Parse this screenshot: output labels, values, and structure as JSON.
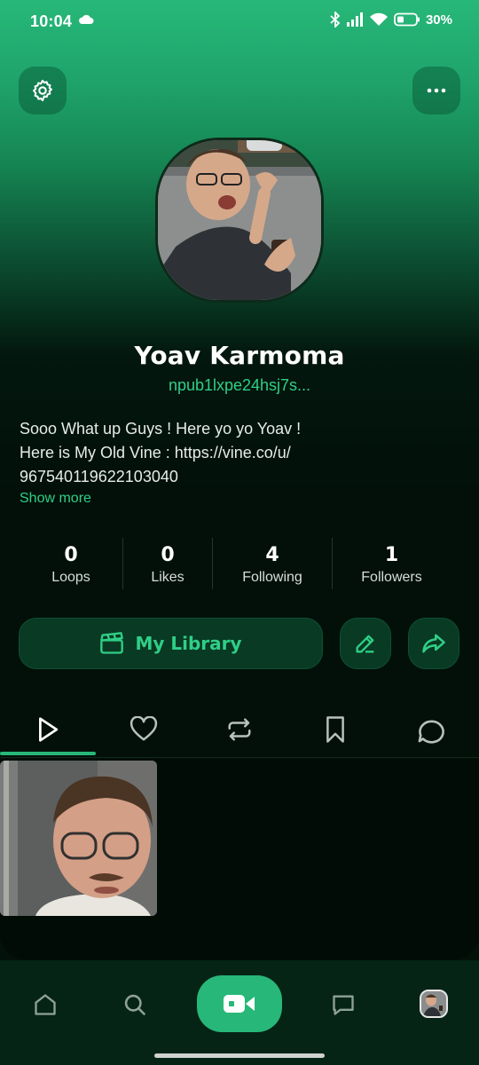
{
  "status_bar": {
    "time": "10:04",
    "battery": "30%"
  },
  "header": {
    "settings_icon": "gear-icon",
    "more_icon": "more-horizontal-icon"
  },
  "profile": {
    "name": "Yoav Karmoma",
    "npub": "npub1lxpe24hsj7s...",
    "bio_lines": [
      "Sooo What up Guys ! Here yo yo Yoav !",
      "Here is My Old Vine : https://vine.co/u/",
      "967540119622103040"
    ],
    "show_more": "Show more"
  },
  "stats": [
    {
      "value": "0",
      "label": "Loops"
    },
    {
      "value": "0",
      "label": "Likes"
    },
    {
      "value": "4",
      "label": "Following"
    },
    {
      "value": "1",
      "label": "Followers"
    }
  ],
  "actions": {
    "library_label": "My Library",
    "library_icon": "clapperboard-icon",
    "edit_icon": "pencil-icon",
    "share_icon": "share-arrow-icon"
  },
  "tabs": [
    {
      "icon": "play-icon",
      "active": true
    },
    {
      "icon": "heart-icon",
      "active": false
    },
    {
      "icon": "repost-icon",
      "active": false
    },
    {
      "icon": "bookmark-icon",
      "active": false
    },
    {
      "icon": "comment-icon",
      "active": false
    }
  ],
  "bottom_nav": [
    {
      "icon": "home-icon"
    },
    {
      "icon": "search-icon"
    },
    {
      "icon": "video-camera-icon"
    },
    {
      "icon": "message-icon"
    },
    {
      "icon": "profile-avatar"
    }
  ],
  "colors": {
    "accent": "#27b879",
    "accent_text": "#2fcf86",
    "background": "#021009"
  }
}
